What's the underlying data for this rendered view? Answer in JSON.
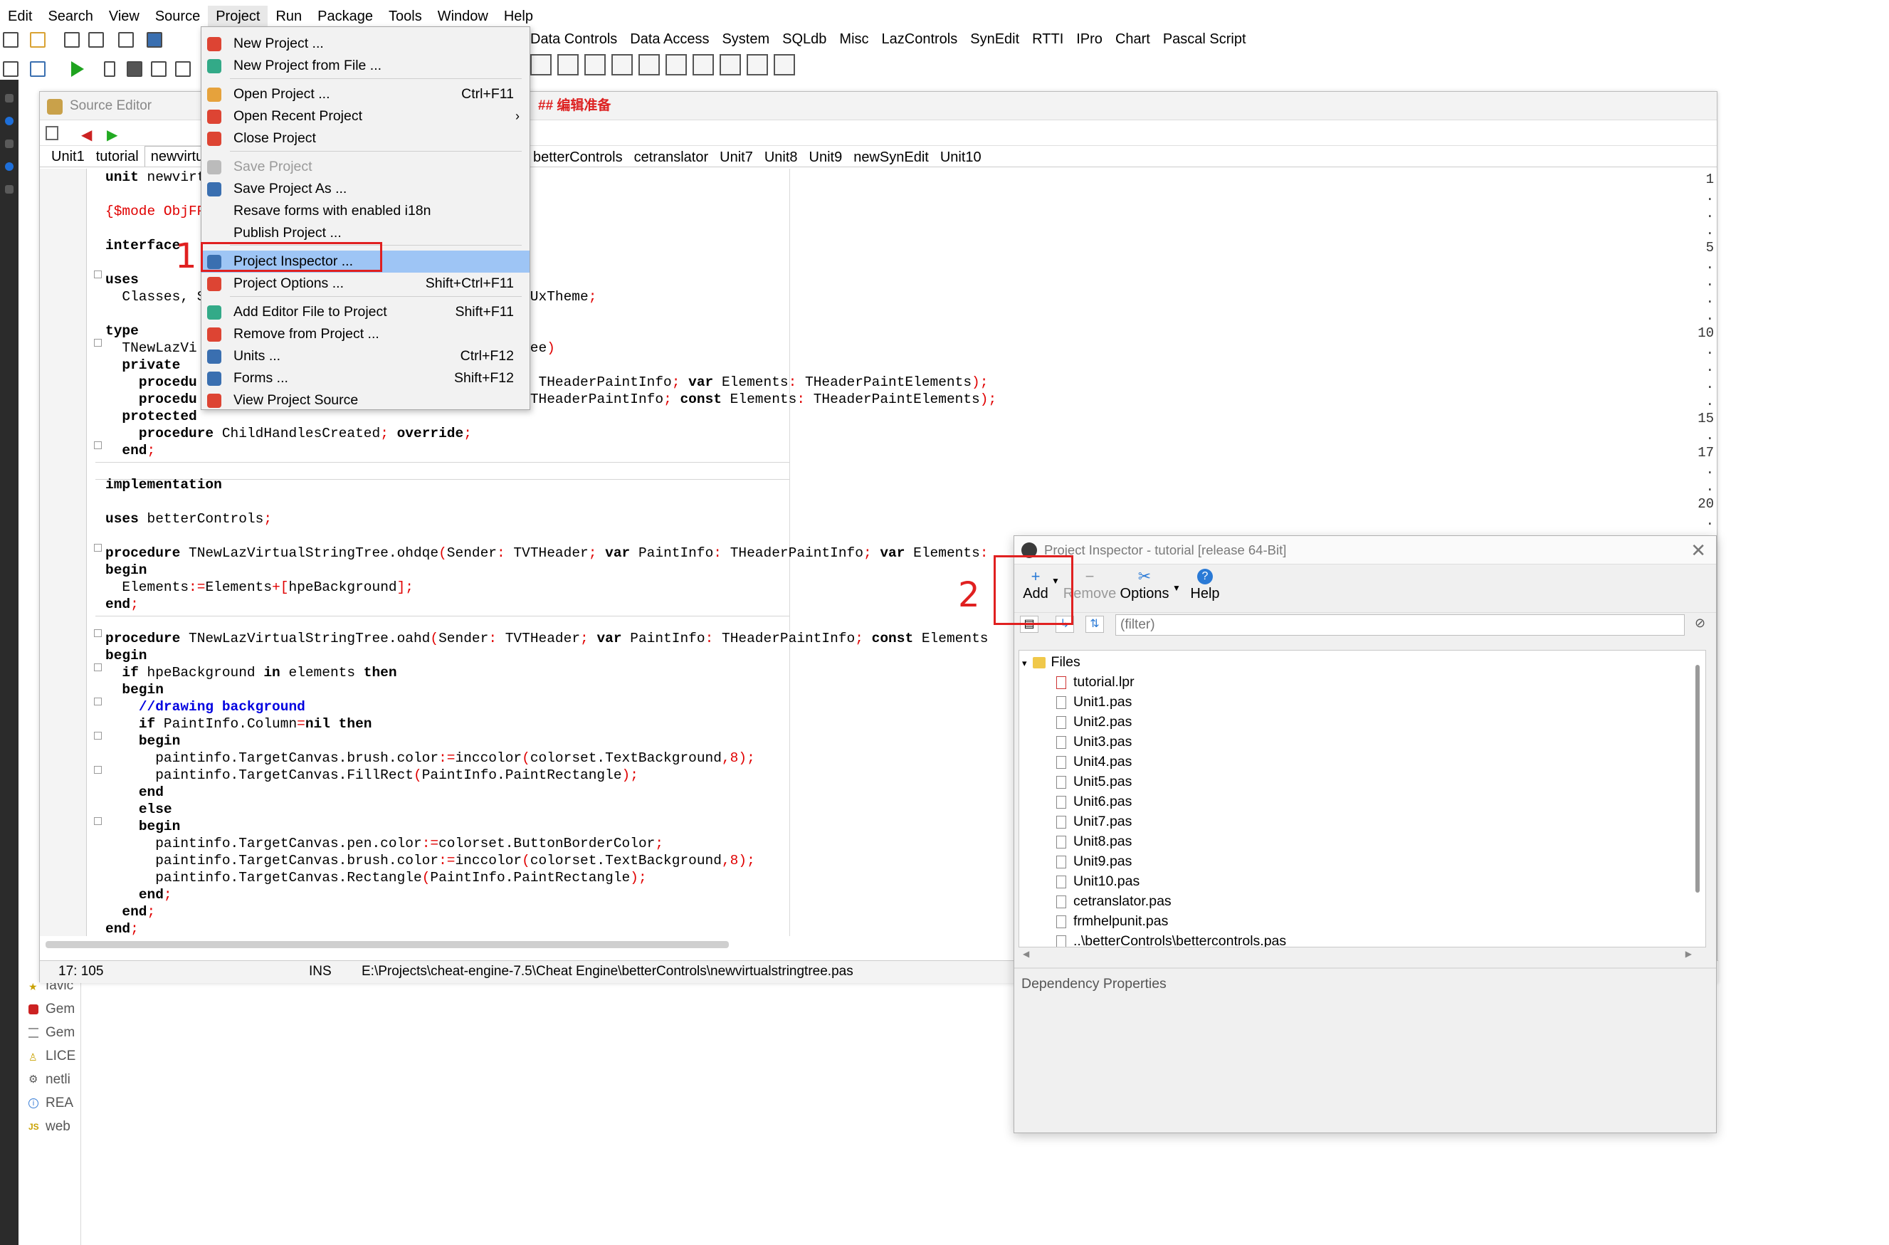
{
  "menubar": [
    "Edit",
    "Search",
    "View",
    "Source",
    "Project",
    "Run",
    "Package",
    "Tools",
    "Window",
    "Help"
  ],
  "palette_tabs": [
    "Data Controls",
    "Data Access",
    "System",
    "SQLdb",
    "Misc",
    "LazControls",
    "SynEdit",
    "RTTI",
    "IPro",
    "Chart",
    "Pascal Script"
  ],
  "editor": {
    "title": "Source Editor",
    "tabs": [
      "Unit1",
      "tutorial",
      "newvirtua"
    ],
    "tabs_right": [
      "betterControls",
      "cetranslator",
      "Unit7",
      "Unit8",
      "Unit9",
      "newSynEdit",
      "Unit10"
    ],
    "status": {
      "pos": "17: 105",
      "mode": "INS",
      "path": "E:\\Projects\\cheat-engine-7.5\\Cheat Engine\\betterControls\\newvirtualstringtree.pas"
    },
    "partial_header": "## 编辑准备"
  },
  "project_menu": {
    "items": [
      {
        "label": "New Project ...",
        "shortcut": "",
        "disabled": false,
        "highlight": false,
        "icon": "new-project-icon"
      },
      {
        "label": "New Project from File ...",
        "shortcut": "",
        "disabled": false,
        "highlight": false,
        "icon": "new-project-file-icon"
      },
      {
        "label": "Open Project ...",
        "shortcut": "Ctrl+F11",
        "disabled": false,
        "highlight": false,
        "icon": "open-project-icon"
      },
      {
        "label": "Open Recent Project",
        "shortcut": "",
        "disabled": false,
        "highlight": false,
        "icon": "recent-project-icon",
        "submenu": true
      },
      {
        "label": "Close Project",
        "shortcut": "",
        "disabled": false,
        "highlight": false,
        "icon": "close-project-icon"
      },
      {
        "label": "Save Project",
        "shortcut": "",
        "disabled": true,
        "highlight": false,
        "icon": "save-project-icon"
      },
      {
        "label": "Save Project As ...",
        "shortcut": "",
        "disabled": false,
        "highlight": false,
        "icon": "save-as-icon"
      },
      {
        "label": "Resave forms with enabled i18n",
        "shortcut": "",
        "disabled": false,
        "highlight": false,
        "icon": ""
      },
      {
        "label": "Publish Project ...",
        "shortcut": "",
        "disabled": false,
        "highlight": false,
        "icon": ""
      },
      {
        "label": "Project Inspector ...",
        "shortcut": "",
        "disabled": false,
        "highlight": true,
        "icon": "project-inspector-icon"
      },
      {
        "label": "Project Options ...",
        "shortcut": "Shift+Ctrl+F11",
        "disabled": false,
        "highlight": false,
        "icon": "project-options-icon"
      },
      {
        "label": "Add Editor File to Project",
        "shortcut": "Shift+F11",
        "disabled": false,
        "highlight": false,
        "icon": "add-file-icon"
      },
      {
        "label": "Remove from Project ...",
        "shortcut": "",
        "disabled": false,
        "highlight": false,
        "icon": "remove-file-icon"
      },
      {
        "label": "Units ...",
        "shortcut": "Ctrl+F12",
        "disabled": false,
        "highlight": false,
        "icon": "units-icon"
      },
      {
        "label": "Forms ...",
        "shortcut": "Shift+F12",
        "disabled": false,
        "highlight": false,
        "icon": "forms-icon"
      },
      {
        "label": "View Project Source",
        "shortcut": "",
        "disabled": false,
        "highlight": false,
        "icon": "project-source-icon"
      }
    ]
  },
  "annotations": {
    "step1": "1",
    "step2": "2"
  },
  "inspector": {
    "title": "Project Inspector - tutorial [release 64-Bit]",
    "toolbar": {
      "add": "Add",
      "remove": "Remove",
      "options": "Options",
      "help": "Help"
    },
    "filter_placeholder": "(filter)",
    "root": "Files",
    "files": [
      "tutorial.lpr",
      "Unit1.pas",
      "Unit2.pas",
      "Unit3.pas",
      "Unit4.pas",
      "Unit5.pas",
      "Unit6.pas",
      "Unit7.pas",
      "Unit8.pas",
      "Unit9.pas",
      "Unit10.pas",
      "cetranslator.pas",
      "frmhelpunit.pas",
      "..\\betterControls\\bettercontrols.pas"
    ],
    "dependency_label": "Dependency Properties"
  },
  "left_files": [
    "favic",
    "Gem",
    "Gem",
    "LICE",
    "netli",
    "REA",
    "web"
  ]
}
